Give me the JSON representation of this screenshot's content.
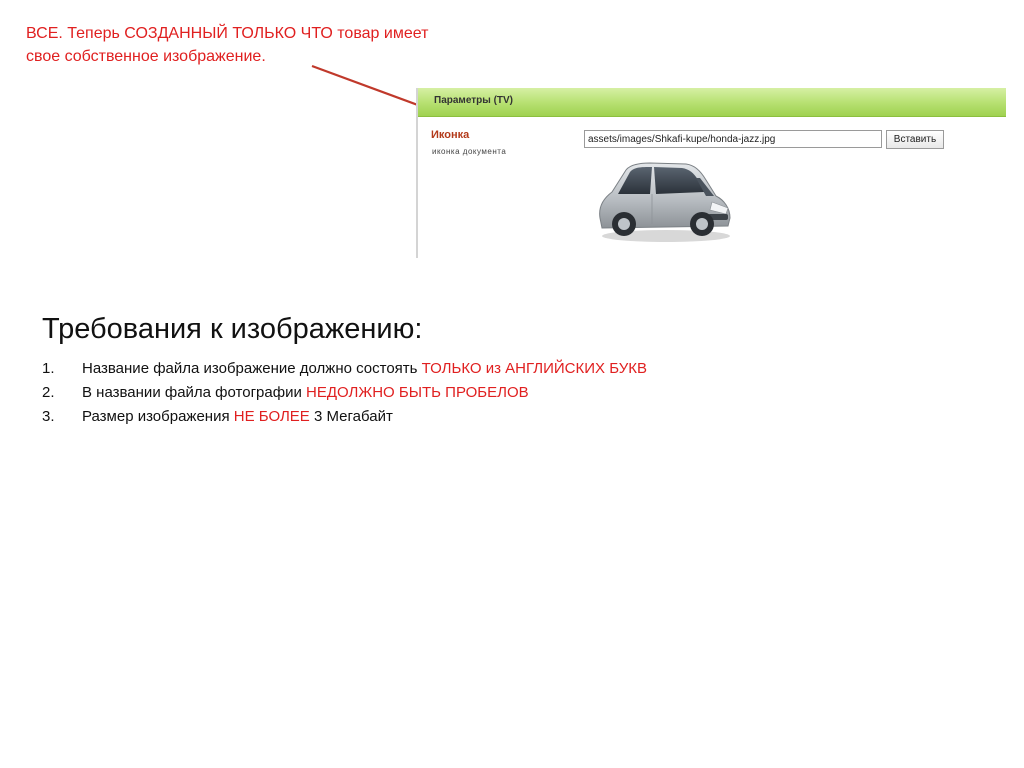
{
  "callout": {
    "line1": "ВСЕ. Теперь СОЗДАННЫЙ ТОЛЬКО ЧТО товар имеет",
    "line2": "свое собственное изображение."
  },
  "panel": {
    "title": "Параметры (TV)",
    "tv_label": "Иконка",
    "tv_desc": "иконка документа",
    "path_value": "assets/images/Shkafi-kupe/honda-jazz.jpg",
    "insert_label": "Вставить",
    "header_color": "#b6e070",
    "car_image": "car-photo-icon"
  },
  "requirements": {
    "heading": "Требования к изображению:",
    "items": [
      {
        "num": "1.",
        "text": "Название файла изображение должно состоять ",
        "highlight": "ТОЛЬКО из АНГЛИЙСКИХ БУКВ",
        "suffix": ""
      },
      {
        "num": "2.",
        "text": "В названии файла фотографии ",
        "highlight": "НЕДОЛЖНО БЫТЬ ПРОБЕЛОВ",
        "suffix": ""
      },
      {
        "num": "3.",
        "text": "Размер изображения ",
        "highlight": "НЕ БОЛЕЕ",
        "suffix": " 3 Мегабайт"
      }
    ]
  },
  "colors": {
    "accent_red": "#e02020",
    "arrow": "#c0392b"
  }
}
